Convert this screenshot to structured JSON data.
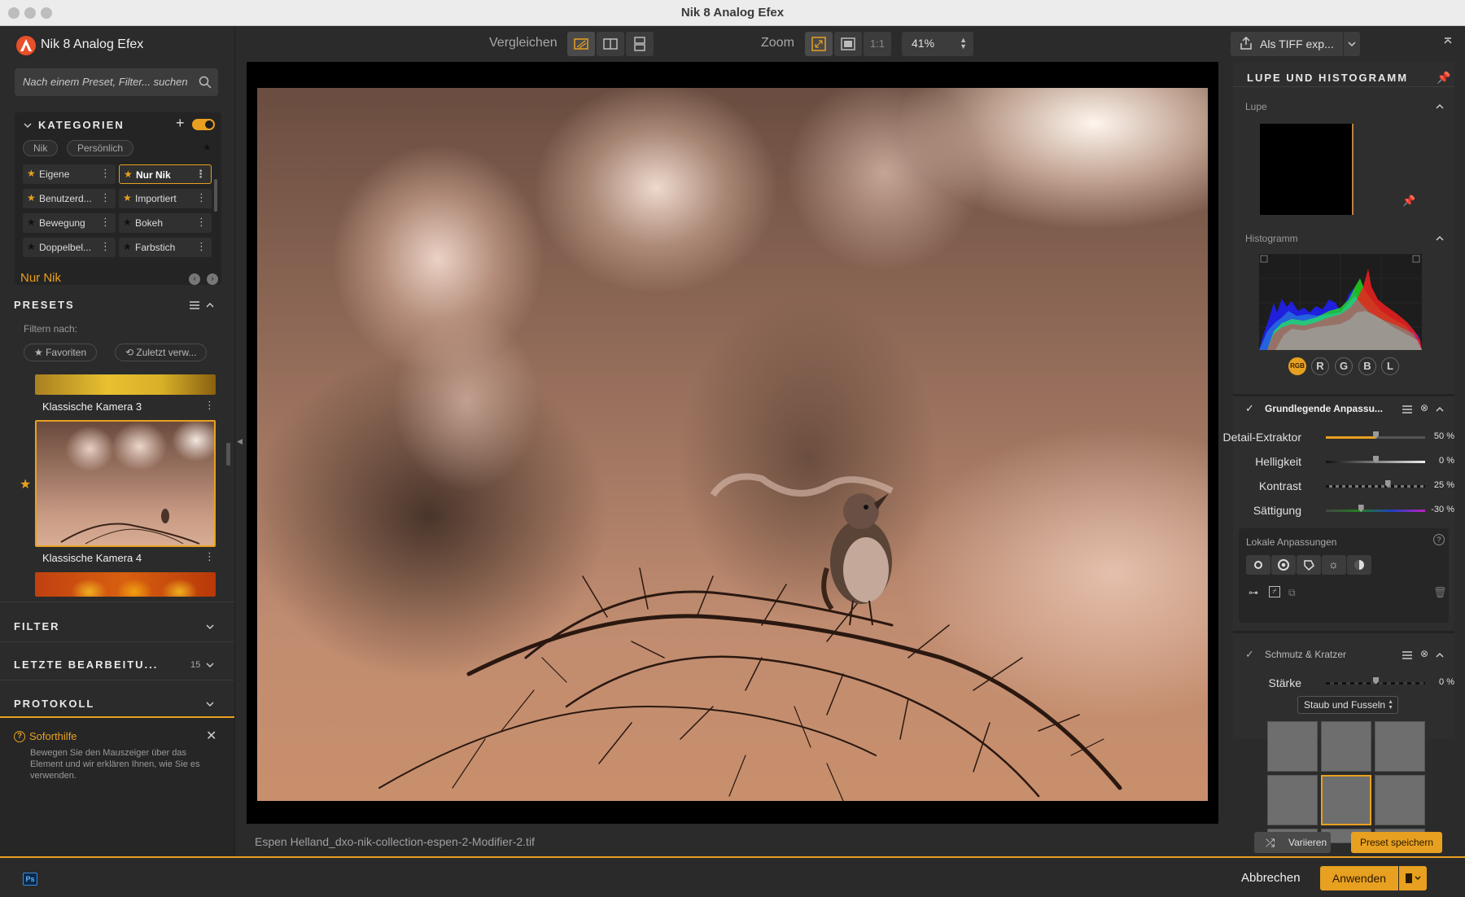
{
  "window": {
    "title": "Nik 8 Analog Efex"
  },
  "app": {
    "name": "Nik 8 Analog Efex"
  },
  "search": {
    "placeholder": "Nach einem Preset, Filter... suchen"
  },
  "categories": {
    "heading": "KATEGORIEN",
    "tabs": [
      "Nik",
      "Persönlich"
    ],
    "items": [
      {
        "label": "Eigene",
        "starred": true
      },
      {
        "label": "Nur Nik",
        "starred": true,
        "active": true
      },
      {
        "label": "Benutzerd...",
        "starred": true
      },
      {
        "label": "Importiert",
        "starred": true
      },
      {
        "label": "Bewegung",
        "starred": false
      },
      {
        "label": "Bokeh",
        "starred": false
      },
      {
        "label": "Doppelbel...",
        "starred": false
      },
      {
        "label": "Farbstich",
        "starred": false
      }
    ]
  },
  "current_category": "Nur Nik",
  "presets": {
    "heading": "PRESETS",
    "filter_label": "Filtern nach:",
    "filter_favorites": "★ Favoriten",
    "filter_recent": "⟲ Zuletzt verw...",
    "items": [
      {
        "label": "Klassische Kamera 3"
      },
      {
        "label": "Klassische Kamera 4",
        "favorite": true,
        "selected": true
      }
    ]
  },
  "sections": {
    "filter": "FILTER",
    "recent": "LETZTE BEARBEITU...",
    "recent_count": "15",
    "protocol": "PROTOKOLL"
  },
  "help": {
    "title": "Soforthilfe",
    "text": "Bewegen Sie den Mauszeiger über das Element und wir erklären Ihnen, wie Sie es verwenden."
  },
  "toolbar": {
    "compare_label": "Vergleichen",
    "zoom_label": "Zoom",
    "one_to_one": "1:1",
    "zoom_value": "41%"
  },
  "image": {
    "filename": "Espen Helland_dxo-nik-collection-espen-2-Modifier-2.tif"
  },
  "right": {
    "export_label": "Als TIFF exp...",
    "loupe_heading": "LUPE UND HISTOGRAMM",
    "loupe_label": "Lupe",
    "histogram_label": "Histogramm",
    "channels": [
      "RGB",
      "R",
      "G",
      "B",
      "L"
    ],
    "basic": {
      "title": "Grundlegende Anpassu...",
      "sliders": [
        {
          "label": "Detail-Extraktor",
          "value": "50 %",
          "fraction": 0.5,
          "color": "#e8a020"
        },
        {
          "label": "Helligkeit",
          "value": "0 %",
          "fraction": 0.5,
          "color": "#dcdcdc"
        },
        {
          "label": "Kontrast",
          "value": "25 %",
          "fraction": 0.62,
          "color": "#666666"
        },
        {
          "label": "Sättigung",
          "value": "-30 %",
          "fraction": 0.35,
          "color": "#c020c0"
        }
      ]
    },
    "local_label": "Lokale Anpassungen",
    "dirt": {
      "title": "Schmutz & Kratzer",
      "strength_label": "Stärke",
      "strength_value": "0 %",
      "strength_fraction": 0.5,
      "type_value": "Staub und Fusseln"
    },
    "vary_label": "Variieren",
    "save_preset_label": "Preset speichern"
  },
  "bottom": {
    "ps_label": "Ps",
    "cancel_label": "Abbrechen",
    "apply_label": "Anwenden"
  },
  "colors": {
    "accent": "#e8a020",
    "panel": "#2b2b2b",
    "canvas": "#000000"
  }
}
